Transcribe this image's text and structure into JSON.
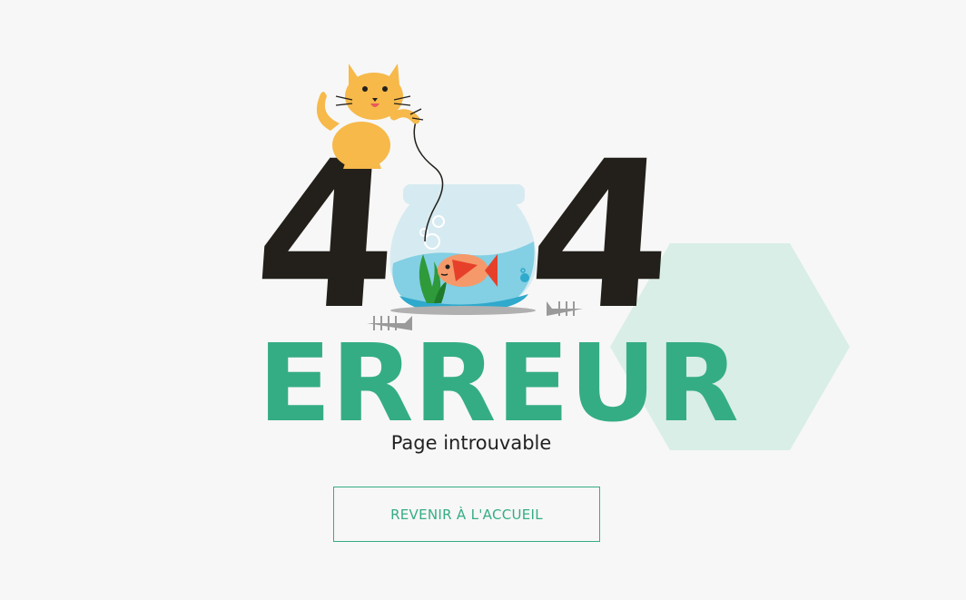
{
  "error": {
    "digit_left": "4",
    "digit_right": "4",
    "title": "ERREUR",
    "subtitle": "Page introuvable"
  },
  "actions": {
    "home_label": "REVENIR À L'ACCUEIL"
  },
  "colors": {
    "background": "#f7f7f7",
    "accent": "#35ad84",
    "digit": "#23201b",
    "hexagon": "#d9eee6",
    "cat": "#f6b94a",
    "fish": "#f0783c",
    "water": "#7fd0e6"
  },
  "illustration": {
    "icons": [
      "cat-icon",
      "fishbowl-icon",
      "goldfish-icon",
      "fish-bone-icon"
    ]
  }
}
